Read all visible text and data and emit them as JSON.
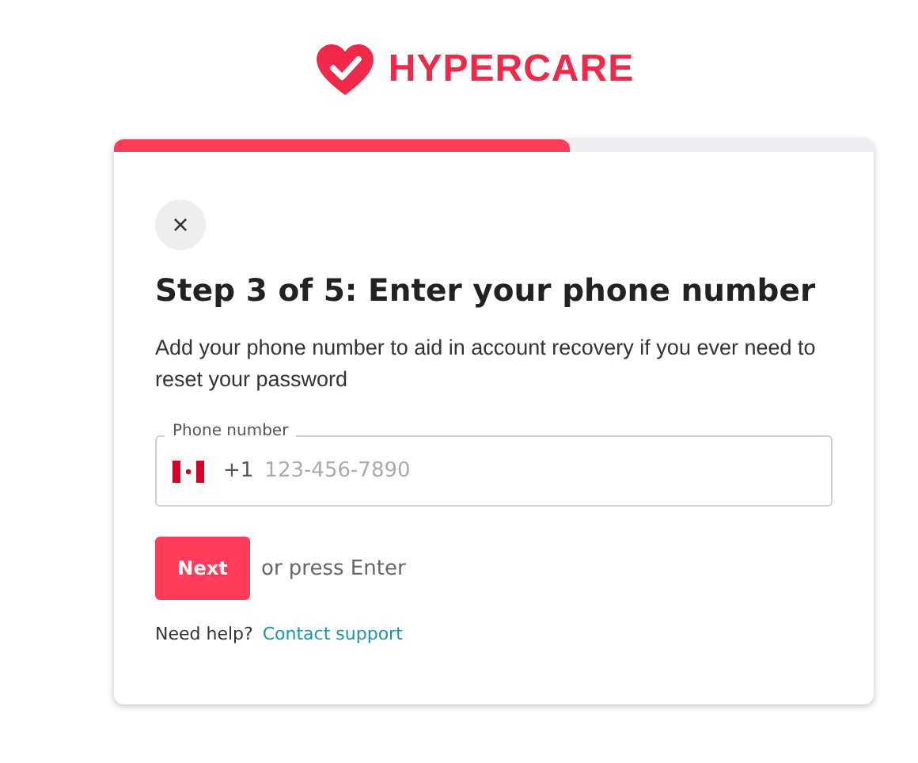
{
  "logo": {
    "text": "HYPERCARE"
  },
  "progress": {
    "level": 0.6
  },
  "close_button": {
    "label": "×"
  },
  "title": "Step 3 of 5: Enter your phone number",
  "description": "Add your phone number to aid in account recovery if you ever need to reset your password",
  "phone_field": {
    "label": "Phone number",
    "country_code": "+1",
    "placeholder": "123-456-7890"
  },
  "next_button": {
    "label": "Next"
  },
  "hint": "or press Enter",
  "help": {
    "text": "Need help?",
    "link": "Contact support"
  }
}
